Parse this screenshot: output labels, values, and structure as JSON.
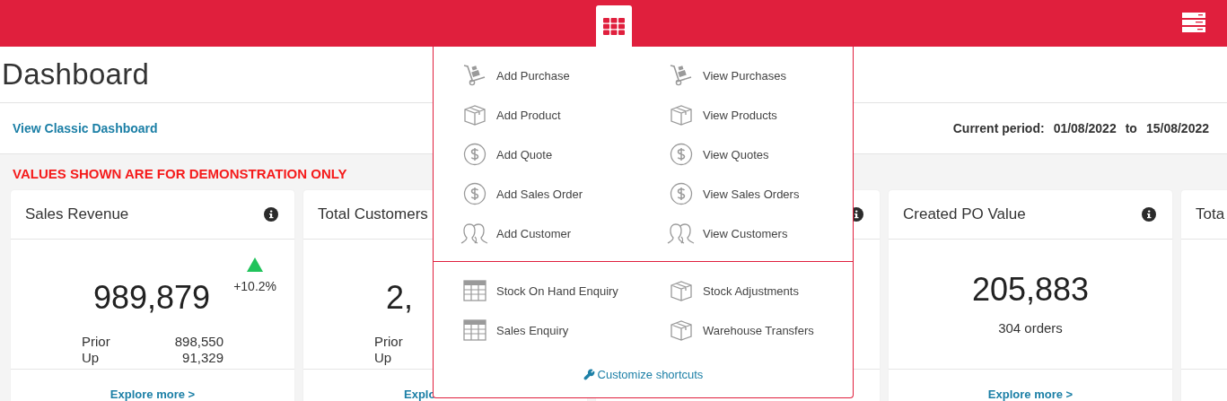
{
  "header": {
    "apps_menu": {
      "expanded": true
    }
  },
  "page": {
    "title": "Dashboard",
    "classic_link": "View Classic Dashboard",
    "period": {
      "label": "Current period:",
      "from": "01/08/2022",
      "to_label": "to",
      "to": "15/08/2022"
    }
  },
  "notice": "VALUES SHOWN ARE FOR DEMONSTRATION ONLY",
  "cards": [
    {
      "kind": "comparison",
      "title": "Sales Revenue",
      "info": true,
      "value": "989,879",
      "trend_up": true,
      "change": "+10.2%",
      "rows": [
        {
          "label": "Prior",
          "value": "898,550"
        },
        {
          "label": "Up",
          "value": "91,329"
        }
      ],
      "link": "Explore more >"
    },
    {
      "kind": "comparison",
      "title": "Total Customers",
      "info": false,
      "value": "2,",
      "rows": [
        {
          "label": "Prior"
        },
        {
          "label": "Up"
        }
      ],
      "link": "Explo"
    },
    {
      "kind": "hidden",
      "info": true
    },
    {
      "kind": "orders",
      "title": "Created PO Value",
      "info": true,
      "value": "205,883",
      "subtitle": "304 orders",
      "link": "Explore more >"
    },
    {
      "kind": "hidden",
      "title": "Tota",
      "info": false
    }
  ],
  "shortcuts": {
    "sections": [
      {
        "items": [
          {
            "label": "Add Purchase",
            "kind": "cart"
          },
          {
            "label": "View Purchases",
            "kind": "cart"
          },
          {
            "label": "Add Product",
            "kind": "box"
          },
          {
            "label": "View Products",
            "kind": "box"
          },
          {
            "label": "Add Quote",
            "kind": "dollar"
          },
          {
            "label": "View Quotes",
            "kind": "dollar"
          },
          {
            "label": "Add Sales Order",
            "kind": "dollar"
          },
          {
            "label": "View Sales Orders",
            "kind": "dollar"
          },
          {
            "label": "Add Customer",
            "kind": "people"
          },
          {
            "label": "View Customers",
            "kind": "people"
          }
        ]
      },
      {
        "items": [
          {
            "label": "Stock On Hand Enquiry",
            "kind": "table"
          },
          {
            "label": "Stock Adjustments",
            "kind": "box"
          },
          {
            "label": "Sales Enquiry",
            "kind": "table"
          },
          {
            "label": "Warehouse Transfers",
            "kind": "box"
          }
        ]
      }
    ],
    "customize": "Customize shortcuts"
  }
}
